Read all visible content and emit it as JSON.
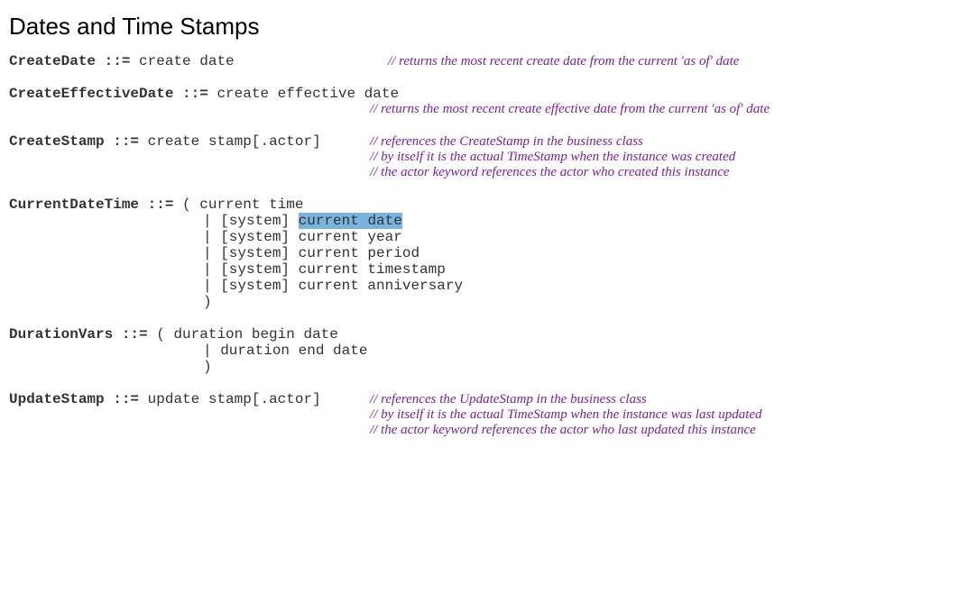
{
  "heading": "Dates and Time Stamps",
  "rules": {
    "createDate": {
      "name": "CreateDate",
      "op": " ::= ",
      "body": "create date",
      "comment1": "// returns the most recent create date from the current 'as of' date"
    },
    "createEffectiveDate": {
      "name": "CreateEffectiveDate",
      "op": " ::= ",
      "body": "create effective date",
      "comment1": "// returns the most recent create effective date from the current 'as of' date"
    },
    "createStamp": {
      "name": "CreateStamp",
      "op": " ::= ",
      "body": "create stamp[.actor]",
      "comment1": "// references the CreateStamp in the business class",
      "comment2": "// by itself it is the actual TimeStamp when the instance was created",
      "comment3": "// the actor keyword references the actor who created this instance"
    },
    "currentDateTime": {
      "name": "CurrentDateTime",
      "op": " ::= ",
      "open": " ( ",
      "alt1": "current time",
      "alt2a": "| [system] ",
      "alt2b": "current date",
      "alt3": "| [system] current year",
      "alt4": "| [system] current period",
      "alt5": "| [system] current timestamp",
      "alt6": "| [system] current anniversary",
      "close": ")"
    },
    "durationVars": {
      "name": "DurationVars",
      "op": " ::= ",
      "open": "   ( ",
      "alt1": "duration begin date",
      "alt2": "| duration end date",
      "close": ")"
    },
    "updateStamp": {
      "name": "UpdateStamp",
      "op": " ::= ",
      "body": "update stamp[.actor]",
      "comment1": "// references the UpdateStamp in the business class",
      "comment2": "// by itself it is the actual TimeStamp when the instance was last updated",
      "comment3": "// the actor keyword references the actor who last updated this instance"
    }
  }
}
